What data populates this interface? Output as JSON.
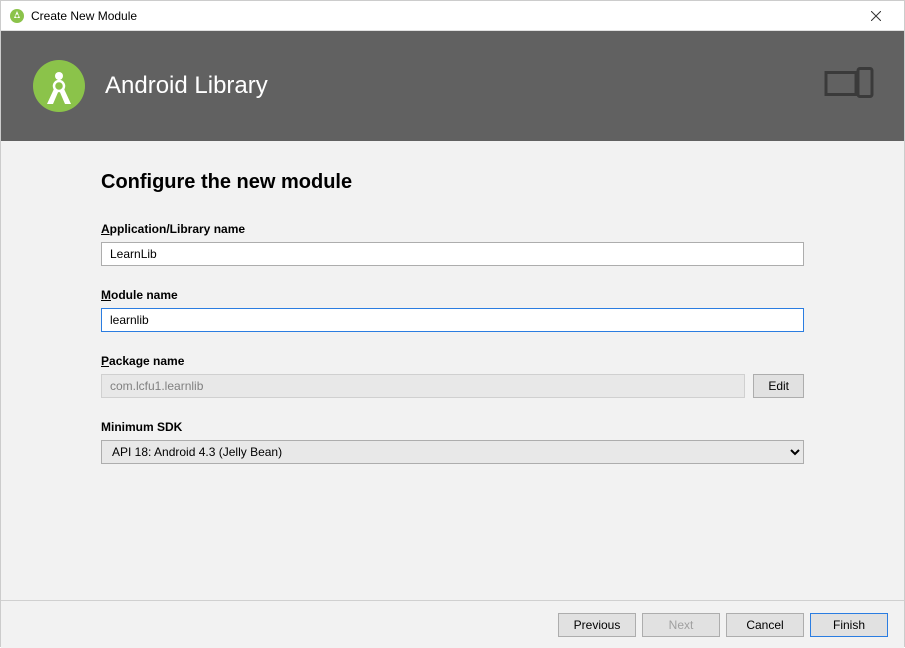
{
  "titlebar": {
    "title": "Create New Module"
  },
  "banner": {
    "title": "Android Library"
  },
  "page": {
    "heading": "Configure the new module"
  },
  "fields": {
    "app_name": {
      "label_prefix": "A",
      "label_rest": "pplication/Library name",
      "value": "LearnLib"
    },
    "module_name": {
      "label_prefix": "M",
      "label_rest": "odule name",
      "value": "learnlib"
    },
    "package_name": {
      "label_prefix": "P",
      "label_rest": "ackage name",
      "value": "com.lcfu1.learnlib",
      "edit_label": "Edit"
    },
    "min_sdk": {
      "label": "Minimum SDK",
      "value": "API 18: Android 4.3 (Jelly Bean)"
    }
  },
  "footer": {
    "previous": "Previous",
    "next": "Next",
    "cancel": "Cancel",
    "finish": "Finish"
  }
}
